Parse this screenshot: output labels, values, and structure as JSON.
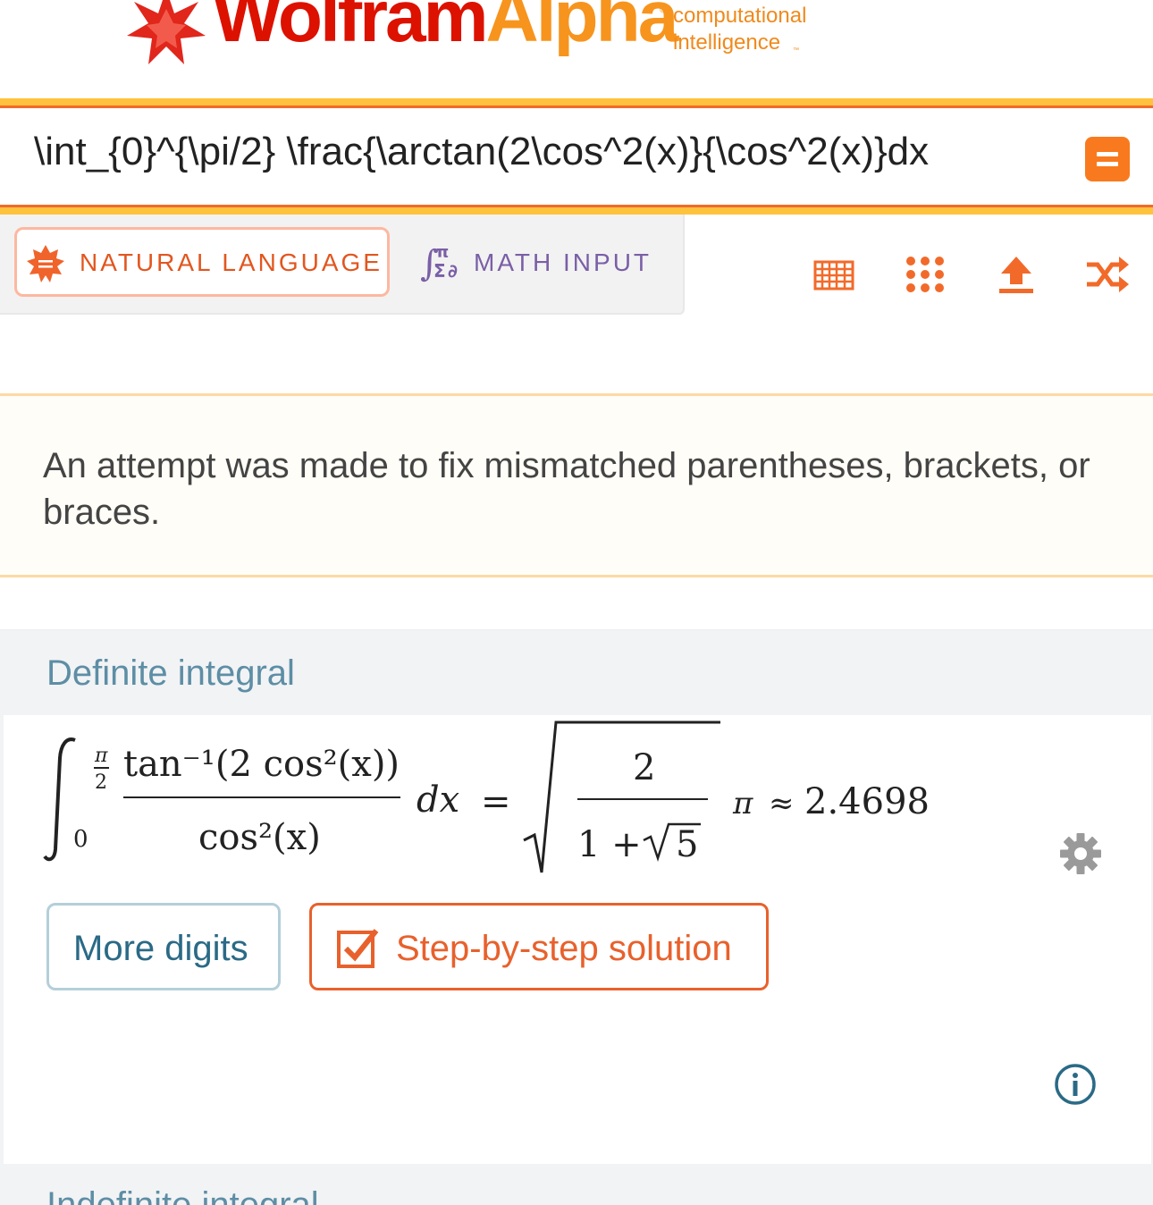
{
  "header": {
    "brand_part1": "Wolfram",
    "brand_part2": "Alpha",
    "tagline_line1": "computational",
    "tagline_line2": "intelligence",
    "trademark": "™",
    "registered": "®",
    "brand_red": "#dd1100",
    "brand_orange": "#f7941d"
  },
  "search": {
    "query": "\\int_{0}^{\\pi/2} \\frac{\\arctan(2\\cos^2(x)}{\\cos^2(x)}dx",
    "submit_icon": "equals-icon"
  },
  "input_modes": {
    "natural": {
      "label": "NATURAL LANGUAGE",
      "icon": "wolfram-spikey-icon",
      "selected": true
    },
    "math": {
      "label": "MATH INPUT",
      "icon": "math-input-icon",
      "selected": false
    }
  },
  "toolbar": {
    "icons": [
      "keyboard-grid-icon",
      "dots-grid-icon",
      "upload-icon",
      "shuffle-icon"
    ]
  },
  "notice": {
    "text": "An attempt was made to fix mismatched parentheses, brackets, or braces."
  },
  "pod": {
    "title": "Definite integral",
    "formula": {
      "lower_limit": "0",
      "upper_num": "π",
      "upper_den": "2",
      "numerator": "tan⁻¹(2 cos²(x))",
      "denominator": "cos²(x)",
      "differential": "dx",
      "equals": "=",
      "sqrt_num": "2",
      "sqrt_den_a": "1 +",
      "sqrt_den_b": "5",
      "pi": "π",
      "approx": "≈",
      "value": "2.4698"
    },
    "buttons": {
      "more_digits": "More digits",
      "step_by_step": "Step-by-step solution"
    },
    "accent": "#e8612c"
  },
  "next_pod": {
    "title": "Indefinite integral"
  }
}
